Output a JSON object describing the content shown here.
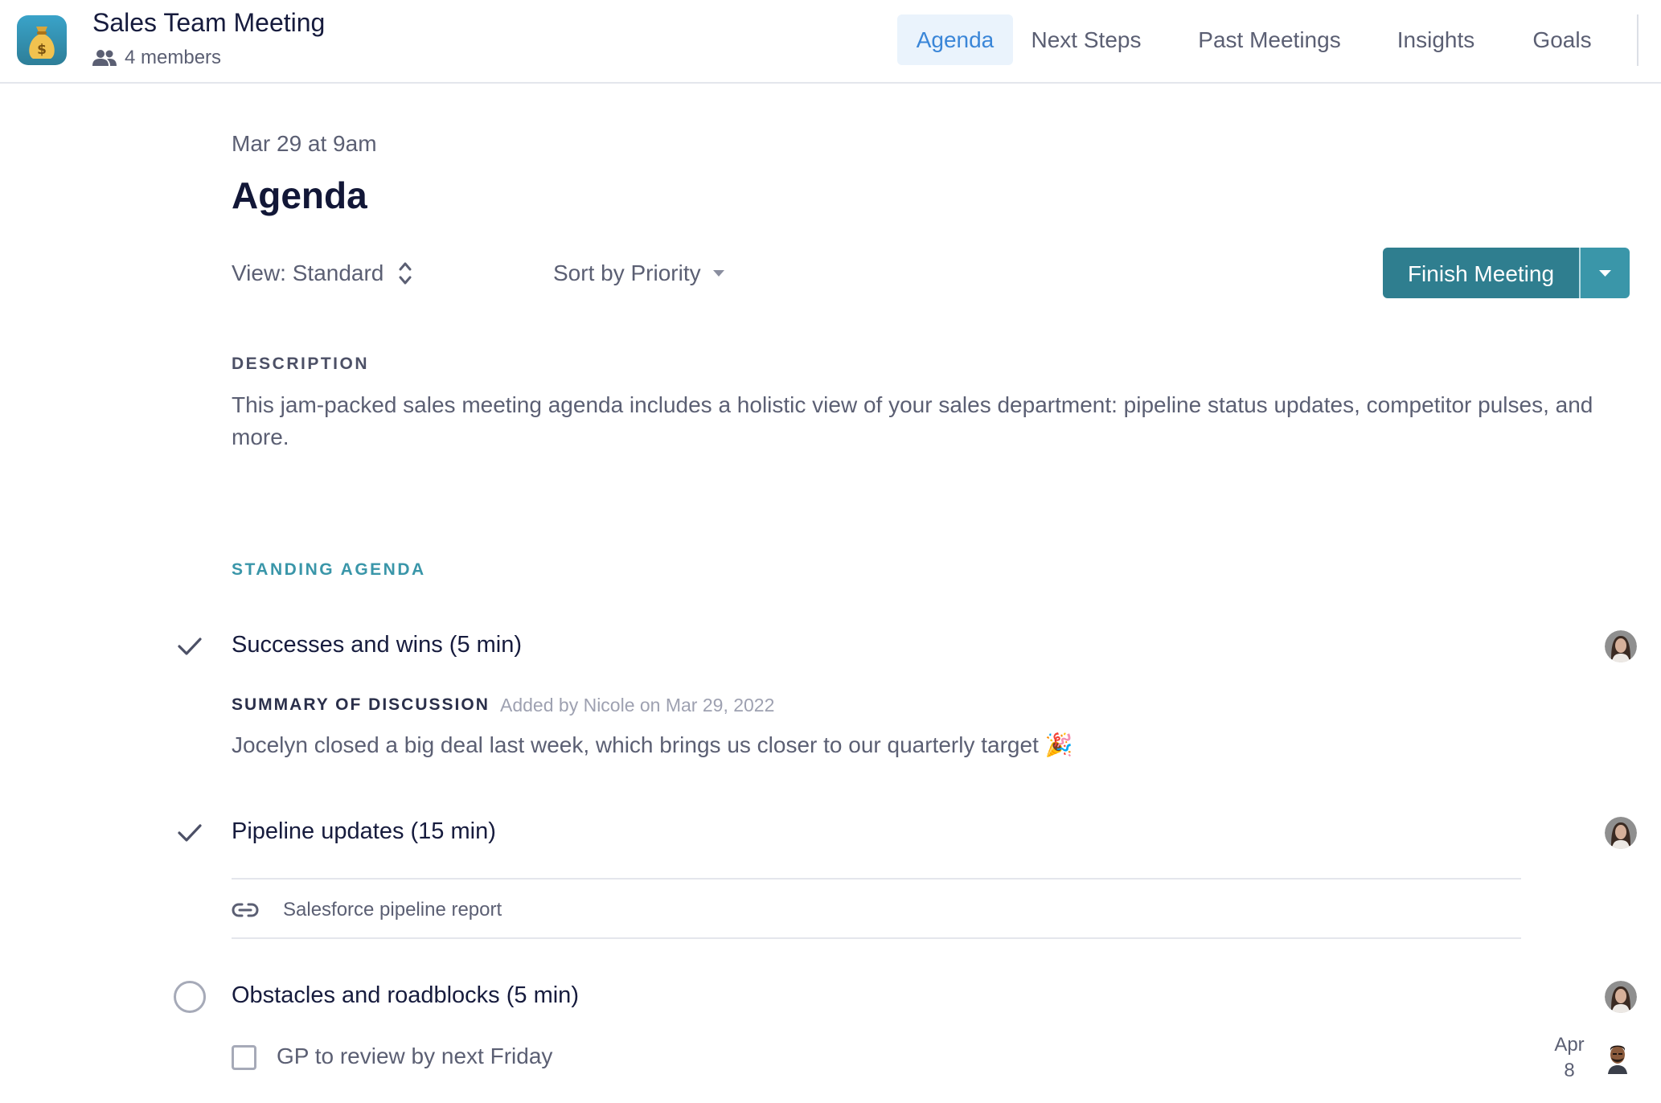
{
  "header": {
    "team_name": "Sales Team Meeting",
    "members_label": "4 members",
    "tabs": [
      {
        "label": "Agenda",
        "active": true
      },
      {
        "label": "Next Steps",
        "active": false
      },
      {
        "label": "Past Meetings",
        "active": false
      },
      {
        "label": "Insights",
        "active": false
      },
      {
        "label": "Goals",
        "active": false
      }
    ]
  },
  "meeting": {
    "date": "Mar 29 at 9am",
    "title": "Agenda"
  },
  "controls": {
    "view_label": "View: Standard",
    "sort_label": "Sort by Priority",
    "finish_button": "Finish Meeting"
  },
  "description": {
    "label": "DESCRIPTION",
    "text": "This jam-packed sales meeting agenda includes a holistic view of your sales department: pipeline status updates, competitor pulses, and more."
  },
  "standing_agenda": {
    "label": "STANDING AGENDA",
    "items": [
      {
        "title": "Successes and wins (5 min)",
        "completed": true,
        "summary_label": "SUMMARY OF DISCUSSION",
        "summary_meta": "Added by Nicole on Mar 29, 2022",
        "summary_text": "Jocelyn closed a big deal last week, which brings us closer to our quarterly target 🎉"
      },
      {
        "title": "Pipeline updates (15 min)",
        "completed": true,
        "link_text": "Salesforce pipeline report"
      },
      {
        "title": "Obstacles and roadblocks (5 min)",
        "completed": false,
        "task": {
          "text": "GP to review by next Friday",
          "due_month": "Apr",
          "due_day": "8"
        }
      }
    ]
  },
  "colors": {
    "accent": "#3a96a9",
    "primary_button": "#2f7e8f",
    "active_tab_bg": "#eaf3fc",
    "active_tab_text": "#3a86d8",
    "text_dark": "#161b3d",
    "text_muted": "#5b5f73"
  },
  "icons": {
    "app": "money-bag-icon",
    "members": "people-icon",
    "view_toggle": "chevron-up-down-icon",
    "sort": "caret-down-icon",
    "completed": "check-icon",
    "pending": "circle-icon",
    "link": "link-icon"
  }
}
